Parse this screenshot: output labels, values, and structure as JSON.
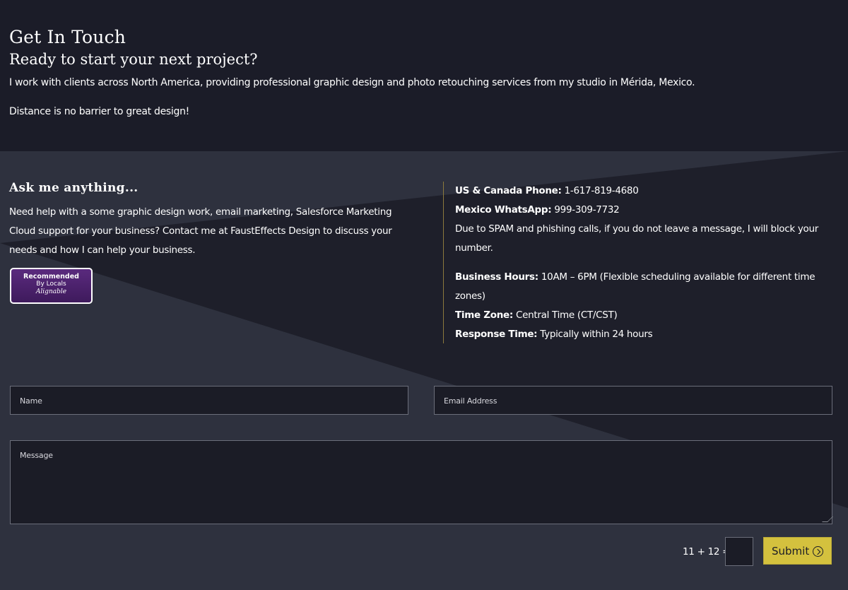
{
  "hero": {
    "title": "Get In Touch",
    "subtitle": "Ready to start your next project?",
    "paragraph1": "I work with clients across North America, providing professional graphic design and photo retouching services from my studio in Mérida, Mexico.",
    "paragraph2": "Distance is no barrier to great design!"
  },
  "ask": {
    "title": "Ask me anything...",
    "text": "Need help with a some graphic design work, email marketing, Salesforce Marketing Cloud support for your business? Contact me at FaustEffects Design to discuss your needs and how I can help your business."
  },
  "badge": {
    "line1": "Recommended",
    "line2": "By Locals",
    "line3": "Alignable"
  },
  "contact": {
    "phone_label": "US & Canada Phone:",
    "phone_value": " 1-617-819-4680",
    "whatsapp_label": "Mexico WhatsApp:",
    "whatsapp_value": " 999-309-7732",
    "spam_note": "Due to SPAM and phishing calls, if you do not leave a message, I will block your number.",
    "hours_label": "Business Hours:",
    "hours_value": " 10AM – 6PM (Flexible scheduling available for different time zones)",
    "timezone_label": "Time Zone:",
    "timezone_value": " Central Time (CT/CST)",
    "response_label": "Response Time:",
    "response_value": " Typically within 24 hours"
  },
  "form": {
    "name_placeholder": "Name",
    "email_placeholder": "Email Address",
    "message_placeholder": "Message",
    "captcha_question": "11 + 12 =",
    "submit_label": "Submit"
  },
  "colors": {
    "hero_bg": "#1b1c28",
    "content_bg": "#2e313e",
    "submit_bg": "#d4c13e",
    "divider": "#8c7a3c",
    "badge_purple": "#4b2170"
  },
  "icons": {
    "submit_icon": "circle-arrow-right-icon"
  }
}
